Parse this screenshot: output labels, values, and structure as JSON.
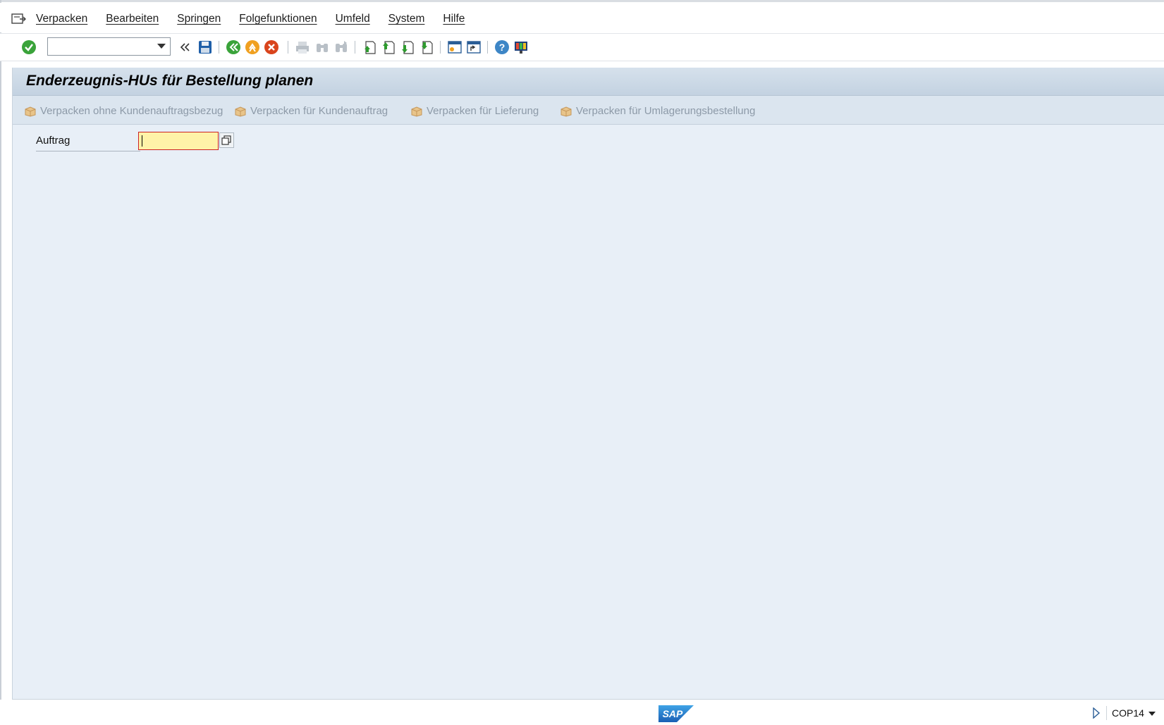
{
  "menubar": {
    "items": [
      {
        "label": "Verpacken"
      },
      {
        "label": "Bearbeiten"
      },
      {
        "label": "Springen"
      },
      {
        "label": "Folgefunktionen"
      },
      {
        "label": "Umfeld"
      },
      {
        "label": "System"
      },
      {
        "label": "Hilfe"
      }
    ]
  },
  "toolbar": {
    "command_field_value": "",
    "icons": [
      "enter-check-icon",
      "command-dropdown-icon",
      "collapse-icon",
      "save-icon",
      "back-icon",
      "exit-icon",
      "cancel-icon",
      "print-icon",
      "find-icon",
      "find-next-icon",
      "first-page-icon",
      "previous-page-icon",
      "next-page-icon",
      "last-page-icon",
      "create-session-icon",
      "create-shortcut-icon",
      "help-icon",
      "customize-layout-icon"
    ]
  },
  "page": {
    "title": "Enderzeugnis-HUs für Bestellung planen"
  },
  "app_toolbar": {
    "buttons": [
      {
        "label": "Verpacken ohne Kundenauftragsbezug",
        "icon": "package-icon"
      },
      {
        "label": "Verpacken für Kundenauftrag",
        "icon": "package-icon"
      },
      {
        "label": "Verpacken für Lieferung",
        "icon": "package-icon"
      },
      {
        "label": "Verpacken für Umlagerungsbestellung",
        "icon": "package-icon"
      }
    ]
  },
  "form": {
    "auftrag_label": "Auftrag",
    "auftrag_value": ""
  },
  "statusbar": {
    "logo_text": "SAP",
    "system": "COP14"
  },
  "colors": {
    "panel_bg": "#e8eff7",
    "title_bar": "#c3d2e1",
    "required_field_bg": "#fff3a8",
    "disabled_text": "#8d9aa8"
  }
}
